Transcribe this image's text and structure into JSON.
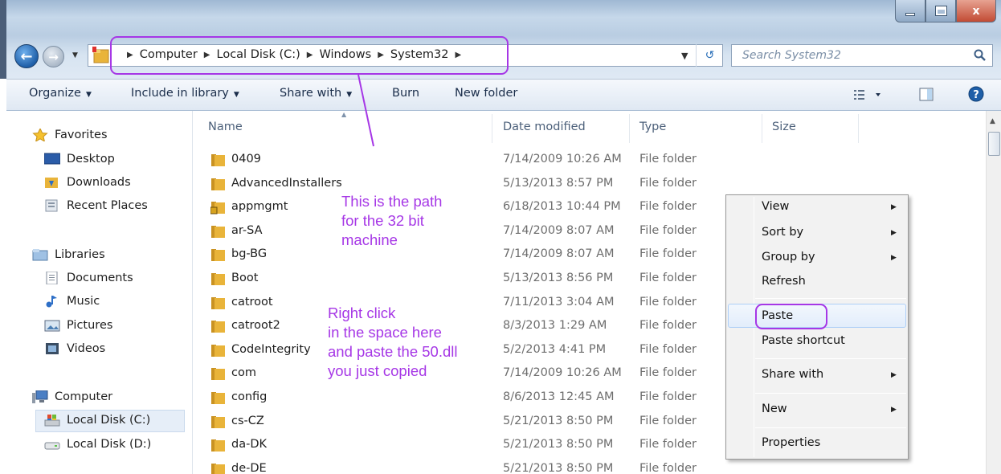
{
  "window": {
    "controls": {
      "minimize_icon": "minimize-icon",
      "maximize_icon": "maximize-icon",
      "close_label": "x"
    }
  },
  "address_bar": {
    "crumbs": [
      "Computer",
      "Local Disk (C:)",
      "Windows",
      "System32"
    ],
    "search_placeholder": "Search System32"
  },
  "toolbar": {
    "organize": "Organize",
    "include_in_library": "Include in library",
    "share_with": "Share with",
    "burn": "Burn",
    "new_folder": "New folder"
  },
  "nav_pane": {
    "favorites": "Favorites",
    "desktop": "Desktop",
    "downloads": "Downloads",
    "recent_places": "Recent Places",
    "libraries": "Libraries",
    "documents": "Documents",
    "music": "Music",
    "pictures": "Pictures",
    "videos": "Videos",
    "computer": "Computer",
    "local_disk_c": "Local Disk (C:)",
    "local_disk_d": "Local Disk (D:)"
  },
  "columns": {
    "name": "Name",
    "date_modified": "Date modified",
    "type": "Type",
    "size": "Size"
  },
  "files": [
    {
      "name": "0409",
      "date": "7/14/2009 10:26 AM",
      "type": "File folder"
    },
    {
      "name": "AdvancedInstallers",
      "date": "5/13/2013 8:57 PM",
      "type": "File folder"
    },
    {
      "name": "appmgmt",
      "date": "6/18/2013 10:44 PM",
      "type": "File folder"
    },
    {
      "name": "ar-SA",
      "date": "7/14/2009 8:07 AM",
      "type": "File folder"
    },
    {
      "name": "bg-BG",
      "date": "7/14/2009 8:07 AM",
      "type": "File folder"
    },
    {
      "name": "Boot",
      "date": "5/13/2013 8:56 PM",
      "type": "File folder"
    },
    {
      "name": "catroot",
      "date": "7/11/2013 3:04 AM",
      "type": "File folder"
    },
    {
      "name": "catroot2",
      "date": "8/3/2013 1:29 AM",
      "type": "File folder"
    },
    {
      "name": "CodeIntegrity",
      "date": "5/2/2013 4:41 PM",
      "type": "File folder"
    },
    {
      "name": "com",
      "date": "7/14/2009 10:26 AM",
      "type": "File folder"
    },
    {
      "name": "config",
      "date": "8/6/2013 12:45 AM",
      "type": "File folder"
    },
    {
      "name": "cs-CZ",
      "date": "5/21/2013 8:50 PM",
      "type": "File folder"
    },
    {
      "name": "da-DK",
      "date": "5/21/2013 8:50 PM",
      "type": "File folder"
    },
    {
      "name": "de-DE",
      "date": "5/21/2013 8:50 PM",
      "type": "File folder"
    }
  ],
  "context_menu": {
    "view": "View",
    "sort_by": "Sort by",
    "group_by": "Group by",
    "refresh": "Refresh",
    "paste": "Paste",
    "paste_shortcut": "Paste shortcut",
    "share_with": "Share with",
    "new": "New",
    "properties": "Properties"
  },
  "annotations": {
    "path_note": [
      "This is the path",
      "for the 32 bit",
      "machine"
    ],
    "paste_note": [
      "Right click",
      "in the space here",
      "and paste the 50.dll",
      "you just copied"
    ],
    "annotation_color": "#a637e6"
  },
  "colors": {
    "folder": "#e9b43a",
    "selection": "#e6eef8",
    "menu_highlight": "#aecff7"
  }
}
